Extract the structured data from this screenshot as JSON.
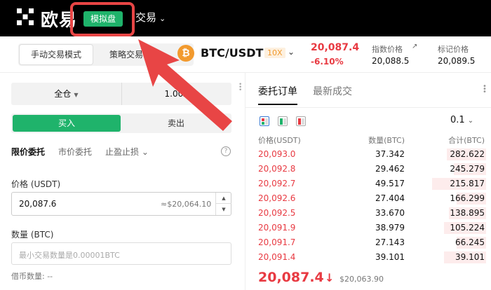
{
  "header": {
    "logo_text": "欧易",
    "demo_badge": "模拟盘",
    "trade_menu": "交易"
  },
  "mode": {
    "manual": "手动交易模式",
    "strategy": "策略交易模"
  },
  "ticker": {
    "coin_symbol": "₿",
    "pair": "BTC/USDT",
    "leverage": "10X",
    "last_price": "20,087.4",
    "change": "-6.10%",
    "index_label": "指数价格",
    "index_value": "20,088.5",
    "mark_label": "标记价格",
    "mark_value": "20,089.5",
    "up_color": "#1fb36b",
    "down_color": "#e83a42"
  },
  "order_form": {
    "margin_mode": "全仓",
    "margin_leverage": "1.00X",
    "buy_label": "买入",
    "sell_label": "卖出",
    "tabs": [
      "限价委托",
      "市价委托",
      "止盈止损"
    ],
    "price_label": "价格 (USDT)",
    "price_value": "20,087.6",
    "price_converted": "≈$20,064.10",
    "qty_label": "数量 (BTC)",
    "qty_placeholder": "最小交易数量是0.00001BTC",
    "borrow_text": "借币数量: --"
  },
  "order_book": {
    "tab_orders": "委托订单",
    "tab_trades": "最新成交",
    "precision": "0.1",
    "col_price": "价格(USDT)",
    "col_qty": "数量(BTC)",
    "col_total": "合计(BTC)",
    "asks": [
      {
        "price": "20,093.0",
        "qty": "37.342",
        "total": "282.622",
        "depth": 0.16
      },
      {
        "price": "20,092.8",
        "qty": "29.462",
        "total": "245.279",
        "depth": 0.13
      },
      {
        "price": "20,092.7",
        "qty": "49.517",
        "total": "215.817",
        "depth": 0.22
      },
      {
        "price": "20,092.6",
        "qty": "27.404",
        "total": "166.299",
        "depth": 0.12
      },
      {
        "price": "20,092.5",
        "qty": "33.670",
        "total": "138.895",
        "depth": 0.15
      },
      {
        "price": "20,091.9",
        "qty": "38.979",
        "total": "105.224",
        "depth": 0.17
      },
      {
        "price": "20,091.7",
        "qty": "27.143",
        "total": "66.245",
        "depth": 0.12
      },
      {
        "price": "20,091.4",
        "qty": "39.101",
        "total": "39.101",
        "depth": 0.17
      }
    ],
    "mid_price": "20,087.4",
    "mid_arrow": "↓",
    "mid_ref": "$20,063.90"
  }
}
